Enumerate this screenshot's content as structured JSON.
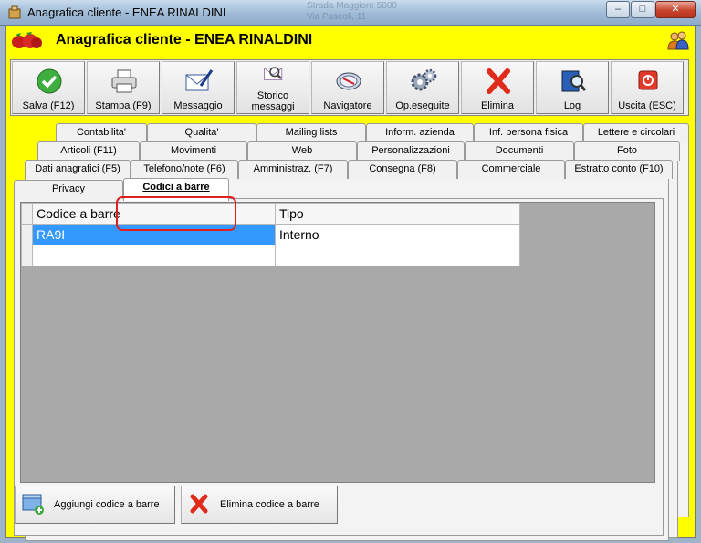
{
  "window": {
    "title": "Anagrafica cliente - ENEA RINALDINI",
    "background_text": "Strada Maggiore 5000",
    "background_text2": "Via Pascoli, 11",
    "minimize_glyph": "–",
    "maximize_glyph": "□",
    "close_glyph": "✕"
  },
  "header": {
    "title": "Anagrafica cliente - ENEA RINALDINI"
  },
  "toolbar": {
    "buttons": [
      {
        "label": "Salva (F12)",
        "icon": "check-icon"
      },
      {
        "label": "Stampa (F9)",
        "icon": "printer-icon"
      },
      {
        "label": "Messaggio",
        "icon": "envelope-pen-icon"
      },
      {
        "label": "Storico messaggi",
        "icon": "envelope-search-icon"
      },
      {
        "label": "Navigatore",
        "icon": "compass-icon"
      },
      {
        "label": "Op.eseguite",
        "icon": "gears-icon"
      },
      {
        "label": "Elimina",
        "icon": "delete-x-icon"
      },
      {
        "label": "Log",
        "icon": "book-search-icon"
      },
      {
        "label": "Uscita (ESC)",
        "icon": "exit-power-icon"
      }
    ]
  },
  "tabs": {
    "row1": [
      "Contabilita'",
      "Qualita'",
      "Mailing lists",
      "Inform. azienda",
      "Inf. persona fisica",
      "Lettere e circolari"
    ],
    "row2": [
      "Articoli (F11)",
      "Movimenti",
      "Web",
      "Personalizzazioni",
      "Documenti",
      "Foto"
    ],
    "row3": [
      "Dati anagrafici (F5)",
      "Telefono/note (F6)",
      "Amministraz. (F7)",
      "Consegna (F8)",
      "Commerciale",
      "Estratto conto (F10)"
    ],
    "row4": [
      "Privacy",
      "Codici a barre"
    ],
    "active": "Codici a barre"
  },
  "grid": {
    "columns": [
      "Codice a barre",
      "Tipo"
    ],
    "rows": [
      [
        "RA9I",
        "Interno"
      ],
      [
        "",
        ""
      ]
    ]
  },
  "bottom": {
    "add_label": "Aggiungi codice a barre",
    "delete_label": "Elimina codice a barre"
  },
  "colors": {
    "background": "#ffff00",
    "selection": "#3399ff",
    "highlight_box": "#e02020"
  }
}
